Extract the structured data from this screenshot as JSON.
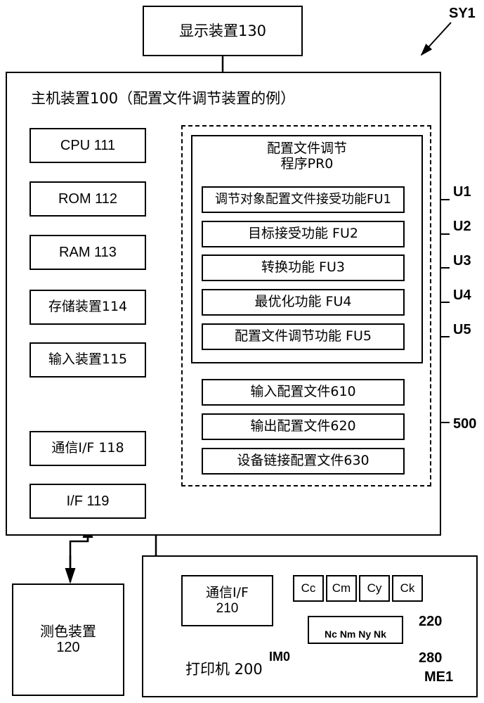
{
  "figure": {
    "system_label": "SY1",
    "type": "patent-block-diagram"
  },
  "display_device": {
    "label": "显示装置130"
  },
  "host_device": {
    "title": "主机装置100（配置文件调节装置的例）",
    "components": [
      {
        "id": "cpu",
        "label": "CPU 111"
      },
      {
        "id": "rom",
        "label": "ROM 112"
      },
      {
        "id": "ram",
        "label": "RAM 113"
      },
      {
        "id": "storage",
        "label": "存储装置114"
      },
      {
        "id": "input",
        "label": "输入装置115"
      },
      {
        "id": "comm-if",
        "label": "通信I/F 118"
      },
      {
        "id": "if",
        "label": "I/F 119"
      }
    ]
  },
  "program": {
    "title_line1": "配置文件调节",
    "title_line2": "程序PR0",
    "functions": [
      {
        "id": "fu1",
        "label": "调节对象配置文件接受功能FU1",
        "tag": "U1"
      },
      {
        "id": "fu2",
        "label": "目标接受功能 FU2",
        "tag": "U2"
      },
      {
        "id": "fu3",
        "label": "转换功能 FU3",
        "tag": "U3"
      },
      {
        "id": "fu4",
        "label": "最优化功能 FU4",
        "tag": "U4"
      },
      {
        "id": "fu5",
        "label": "配置文件调节功能 FU5",
        "tag": "U5"
      }
    ]
  },
  "profiles": {
    "group_tag": "500",
    "items": [
      {
        "id": "pf610",
        "label": "输入配置文件610"
      },
      {
        "id": "pf620",
        "label": "输出配置文件620"
      },
      {
        "id": "pf630",
        "label": "设备链接配置文件630"
      }
    ]
  },
  "colorimeter": {
    "line1": "测色装置",
    "line2": "120"
  },
  "printer": {
    "title": "打印机 200",
    "comm_if_line1": "通信I/F",
    "comm_if_line2": "210",
    "cartridges": [
      {
        "id": "cc",
        "label": "Cc"
      },
      {
        "id": "cm",
        "label": "Cm"
      },
      {
        "id": "cy",
        "label": "Cy"
      },
      {
        "id": "ck",
        "label": "Ck"
      }
    ],
    "head_tag": "220",
    "head_nozzle_labels": "Nc Nm Ny Nk",
    "nozzle_tag": "280",
    "medium_tag": "ME1",
    "image_tag": "IM0"
  }
}
